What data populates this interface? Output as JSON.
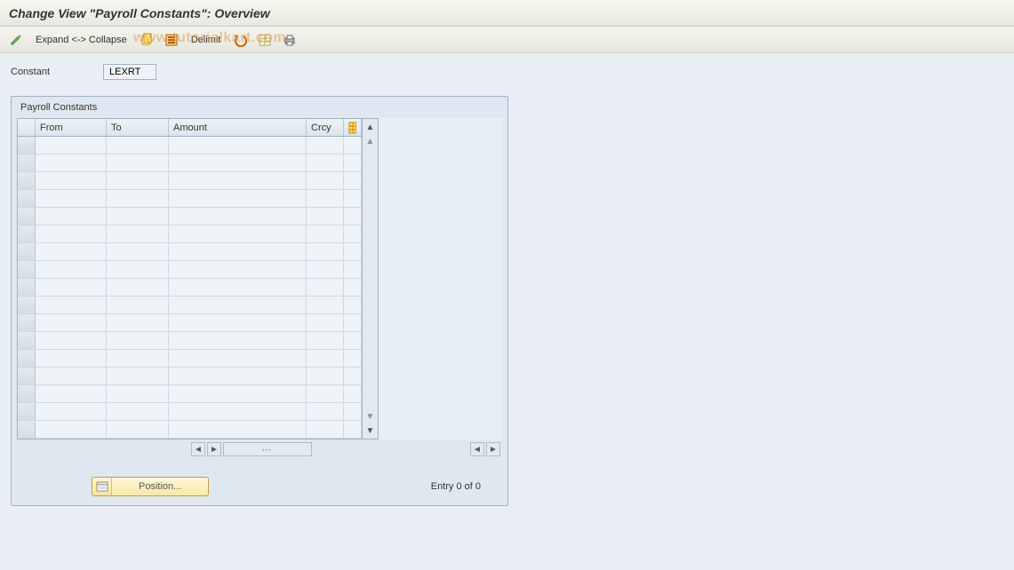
{
  "title": "Change View \"Payroll Constants\": Overview",
  "toolbar": {
    "expand_collapse": "Expand <-> Collapse",
    "delimit": "Delimit"
  },
  "watermark": "www.tutorialkart.com",
  "field": {
    "label": "Constant",
    "value": "LEXRT"
  },
  "panel": {
    "title": "Payroll Constants",
    "columns": {
      "from": "From",
      "to": "To",
      "amount": "Amount",
      "crcy": "Crcy"
    }
  },
  "footer": {
    "position": "Position...",
    "entry_text": "Entry 0 of 0"
  }
}
